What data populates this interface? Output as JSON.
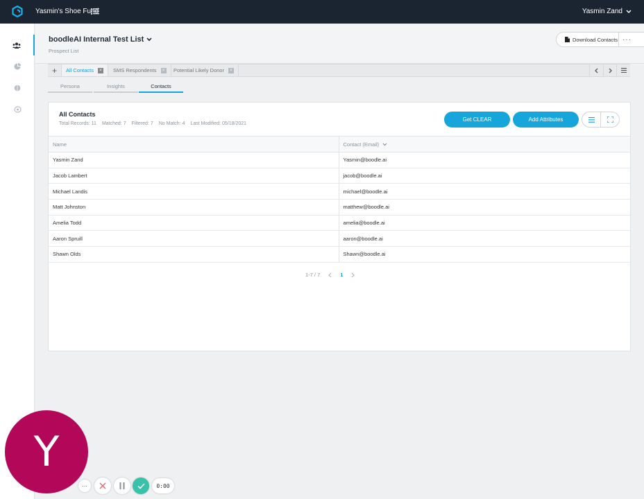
{
  "colors": {
    "topbar": "#1b2532",
    "accent": "#16a6dc",
    "avatar": "#b3085a",
    "confirm": "#38c2a9"
  },
  "topbar": {
    "fund_name": "Yasmin's Shoe Fund",
    "user_name": "Yasmin Zand"
  },
  "sidebar": {
    "items": [
      {
        "icon": "people-icon",
        "active": true
      },
      {
        "icon": "pie-chart-icon"
      },
      {
        "icon": "brain-icon"
      },
      {
        "icon": "brain-outline-icon"
      }
    ]
  },
  "header": {
    "title": "boodleAI Internal Test List",
    "subtitle": "Prospect List",
    "download_label": "Download Contacts",
    "more_label": "···"
  },
  "list_tabs": [
    {
      "label": "All Contacts",
      "active": true
    },
    {
      "label": "SMS Respondents"
    },
    {
      "label": "Potential Likely Donor"
    }
  ],
  "sub_tabs": [
    {
      "label": "Persona"
    },
    {
      "label": "Insights"
    },
    {
      "label": "Contacts",
      "active": true
    }
  ],
  "card": {
    "title": "All Contacts",
    "stats": [
      "Total Records: 11",
      "Matched: 7",
      "Filtered: 7",
      "No Match: 4",
      "Last Modified: 05/18/2021"
    ],
    "get_clear_label": "Get CLEAR",
    "add_attributes_label": "Add Attributes"
  },
  "table": {
    "columns": [
      "Name",
      "Contact (Email)"
    ],
    "rows": [
      [
        "Yasmin Zand",
        "Yasmin@boodle.ai"
      ],
      [
        "Jacob Lambert",
        "jacob@boodle.ai"
      ],
      [
        "Michael Landis",
        "michael@boodle.ai"
      ],
      [
        "Matt Johnston",
        "matthew@boodle.ai"
      ],
      [
        "Amelia Todd",
        "amelia@boodle.ai"
      ],
      [
        "Aaron Spruill",
        "aaron@boodle.ai"
      ],
      [
        "Shawn Olds",
        "Shawn@boodle.ai"
      ]
    ]
  },
  "pagination": {
    "range": "1-7 / 7",
    "current_page": "1"
  },
  "recorder": {
    "avatar_letter": "Y",
    "timer": "0:00"
  }
}
